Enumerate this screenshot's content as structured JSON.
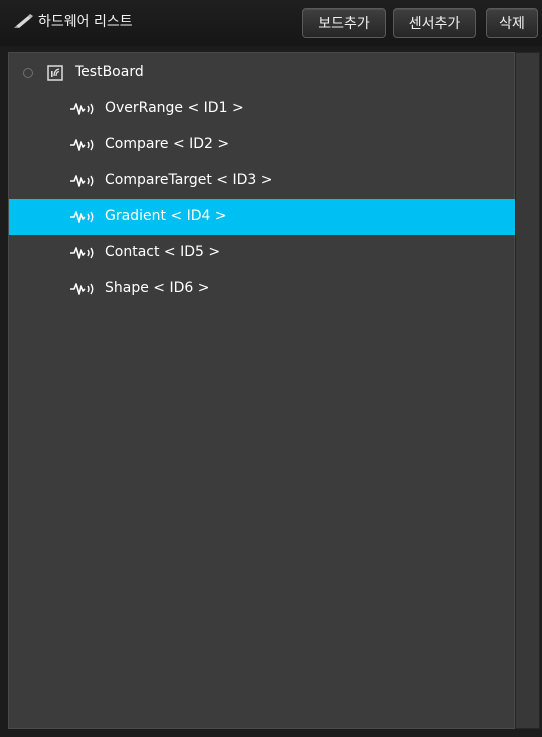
{
  "header": {
    "title": "하드웨어 리스트",
    "title_icon": "pen-icon",
    "buttons": {
      "add_board": "보드추가",
      "add_sensor": "센서추가",
      "delete": "삭제"
    }
  },
  "tree": {
    "board": {
      "label": "TestBoard",
      "icon": "board-icon"
    },
    "sensors": [
      {
        "label": "OverRange < ID1 >",
        "icon": "sensor-wave-icon",
        "selected": false
      },
      {
        "label": "Compare < ID2 >",
        "icon": "sensor-wave-icon",
        "selected": false
      },
      {
        "label": "CompareTarget < ID3 >",
        "icon": "sensor-wave-icon",
        "selected": false
      },
      {
        "label": "Gradient < ID4 >",
        "icon": "sensor-wave-icon",
        "selected": true
      },
      {
        "label": "Contact < ID5 >",
        "icon": "sensor-wave-icon",
        "selected": false
      },
      {
        "label": "Shape < ID6 >",
        "icon": "sensor-wave-icon",
        "selected": false
      }
    ]
  },
  "colors": {
    "selection": "#00bff3",
    "panel": "#3c3c3c",
    "header": "#1c1c1c",
    "text": "#ffffff"
  }
}
